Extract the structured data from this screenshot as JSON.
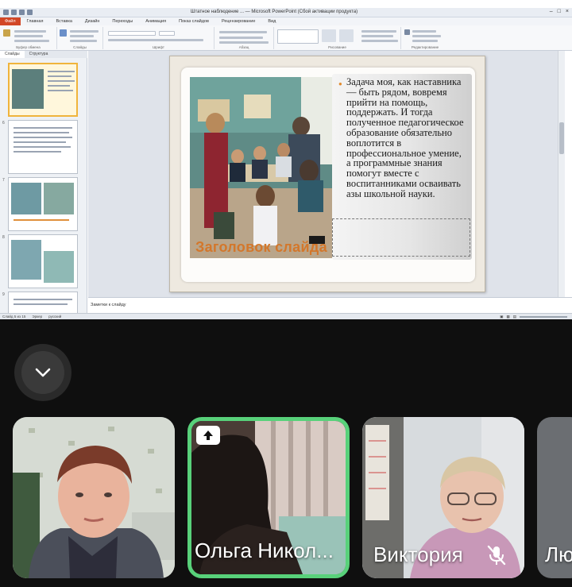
{
  "window": {
    "title": "Штатное наблюдение ... — Microsoft PowerPoint (Сбой активации продукта)"
  },
  "ribbon_tabs": {
    "file": "Файл",
    "items": [
      "Главная",
      "Вставка",
      "Дизайн",
      "Переходы",
      "Анимация",
      "Показ слайдов",
      "Рецензирование",
      "Вид"
    ]
  },
  "ribbon_groups": [
    "Буфер обмена",
    "Слайды",
    "Шрифт",
    "Абзац",
    "Рисование",
    "Редактирование"
  ],
  "side_panel": {
    "tabs": [
      "Слайды",
      "Структура"
    ],
    "thumb_numbers": [
      "6",
      "7",
      "8",
      "9"
    ]
  },
  "slide": {
    "body_text": "Задача моя, как наставника — быть рядом, вовремя прийти на помощь, поддержать. И тогда полученное педагогическое образование обязательно воплотится в профессиональное умение, а программные знания помогут вместе с воспитанниками осваивать азы школьной науки.",
    "placeholder_heading": "Заголовок слайда"
  },
  "notes": {
    "placeholder": "Заметки к слайду"
  },
  "status_bar": {
    "slide_info": "Слайд 5 из 15",
    "theme": "Эркер",
    "language": "русский"
  },
  "participants": [
    {
      "name": "",
      "muted": false
    },
    {
      "name": "Ольга Никол...",
      "muted": false,
      "sharing": true
    },
    {
      "name": "Виктория",
      "muted": true
    },
    {
      "name": "Лю",
      "muted": false
    }
  ],
  "colors": {
    "active_speaker": "#58d17a",
    "slide_accent": "#d3772b",
    "background": "#0f0f0f"
  },
  "icons": {
    "collapse": "chevron-down-icon",
    "share": "arrow-up-icon",
    "muted": "mic-off-icon"
  }
}
